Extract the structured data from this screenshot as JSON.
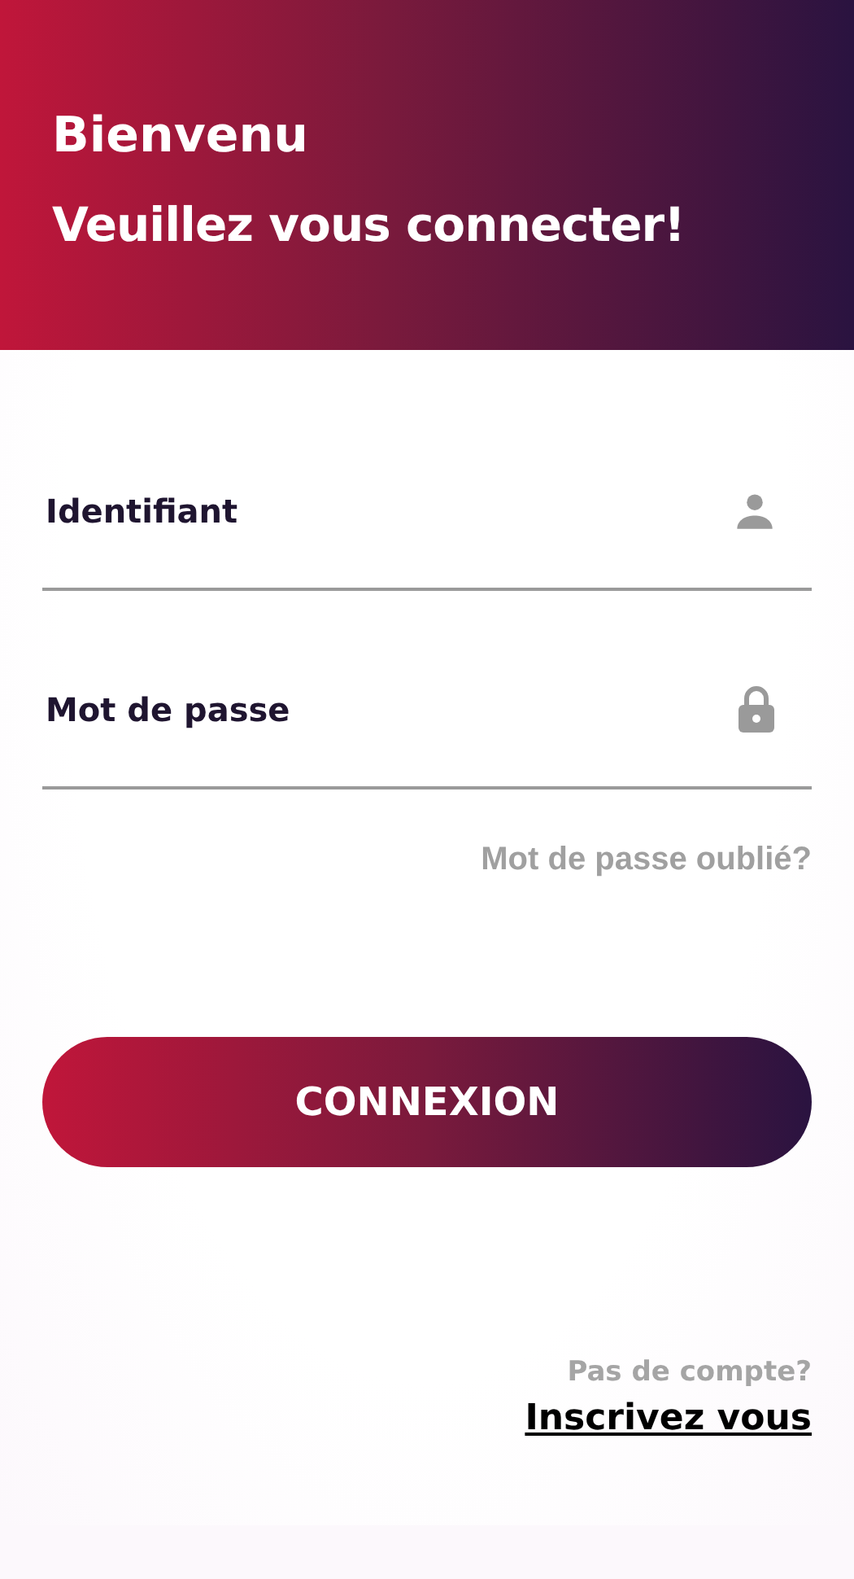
{
  "header": {
    "greeting": "Bienvenu",
    "subtitle": "Veuillez vous connecter!"
  },
  "fields": [
    {
      "placeholder": "Identifiant"
    },
    {
      "placeholder": "Mot de passe"
    }
  ],
  "forgot_link": "Mot de passe oublié?",
  "login_button": "CONNEXION",
  "signup": {
    "prompt": "Pas de compte?",
    "link": "Inscrivez vous"
  }
}
